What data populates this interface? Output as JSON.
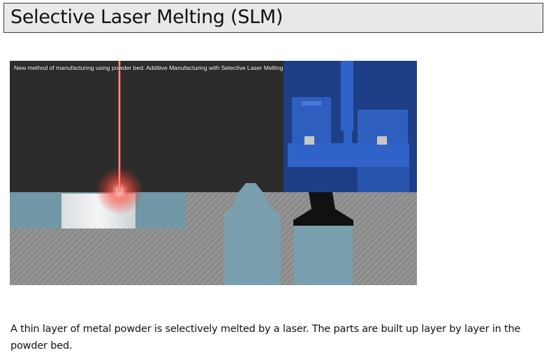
{
  "slide": {
    "title": "Selective Laser Melting (SLM)",
    "body": "A thin layer of metal powder is selectively melted by a laser. The parts are built up layer by layer in the powder bed."
  },
  "video": {
    "caption": "New method of manufacturing using powder bed: Additive Manufacturing with Selective Laser Melting"
  },
  "colors": {
    "title_background": "#e9e9e9",
    "laser": "#ff3b2f",
    "machine_blue": "#2f63c7",
    "powder_blue": "#6f97a6",
    "bed_gray": "#8f8f8f"
  }
}
